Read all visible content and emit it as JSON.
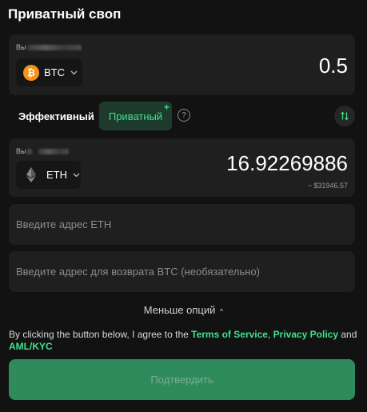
{
  "title": "Приватный своп",
  "from": {
    "label": "Вы",
    "coin": "BTC",
    "amount": "0.5",
    "icon": "bitcoin-icon"
  },
  "mode": {
    "efficient_label": "Эффективный",
    "private_label": "Приватный",
    "private_badge": "+",
    "help": "?",
    "active": "private",
    "accent_color": "#3fe28e"
  },
  "to": {
    "label": "Вы",
    "coin": "ETH",
    "amount": "16.92269886",
    "usd": "~ $31946.57",
    "icon": "ethereum-icon"
  },
  "address": {
    "placeholder": "Введите адрес ETH",
    "value": ""
  },
  "refund": {
    "placeholder": "Введите адрес для возврата BTC (необязательно)",
    "value": ""
  },
  "fewer_options": "Меньше опций",
  "terms": {
    "prefix": "By clicking the button below, I agree to the ",
    "tos": "Terms of Service",
    "sep1": ", ",
    "privacy": "Privacy Policy",
    "sep2": " and ",
    "aml": "AML/KYC"
  },
  "submit_label": "Подтвердить",
  "colors": {
    "background": "#121212",
    "card": "#1f1f1f",
    "accent": "#3fe28e",
    "button": "#2f8a5c"
  }
}
